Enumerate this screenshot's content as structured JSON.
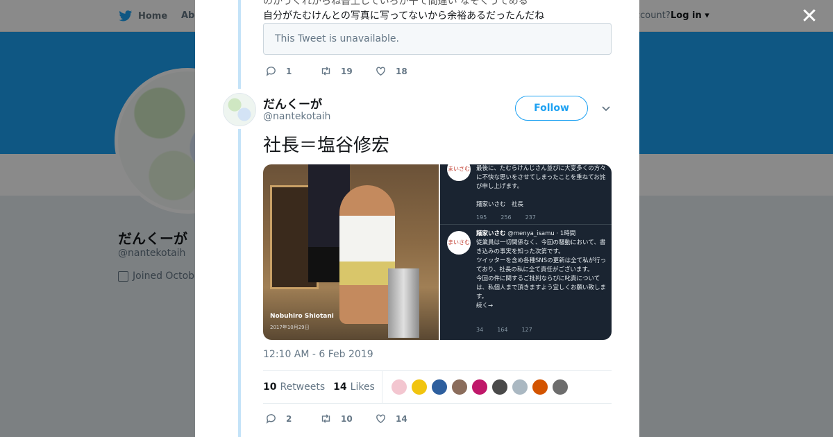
{
  "topbar": {
    "home_label": "Home",
    "about_label": "Abo",
    "account_text": "ccount?",
    "login_label": "Log in ▾"
  },
  "profile": {
    "name": "だんくーが",
    "handle": "@nantekotaih",
    "joined": "Joined Octobe"
  },
  "previous_tweet": {
    "text_line1": "のかうくれがらね普上していろが干て間違い なそくうてめる",
    "text_line2": "自分がたむけんとの写真に写ってないから余裕あるだったんだね",
    "unavailable_text": "This Tweet is unavailable.",
    "replies": "1",
    "retweets": "19",
    "likes": "18"
  },
  "tweet": {
    "name": "だんくーが",
    "handle": "@nantekotaih",
    "follow_label": "Follow",
    "text": "社長＝塩谷修宏",
    "timestamp": "12:10 AM - 6 Feb 2019",
    "retweets_count": "10",
    "retweets_label": "Retweets",
    "likes_count": "14",
    "likes_label": "Likes",
    "replies": "2",
    "retweets": "10",
    "likes": "14",
    "media_left": {
      "caption": "Nobuhiro Shiotani",
      "date": "2017年10月29日"
    },
    "media_right": {
      "avatar_text": "まいさむ",
      "text1": "最後に、たむらけんじさん並びに大変多くの方々に不快な思いをさせてしまったことを重ねてお詫び申し上げます。\n\n麺家いさむ　社長",
      "stats1": {
        "replies": "195",
        "retweets": "256",
        "likes": "237"
      },
      "head_name": "麺家いさむ",
      "head_meta": "@menya_isamu · 1時間",
      "text2": "従業員は一切関係なく、今回の騒動において、書き込みの事実を知った次第です。\nツイッターを含め各種SNSの更新は全て私が行っており、社長の私に全て責任がございます。\n今回の件に関するご批判ならびに叱責については、私個人まで頂きますよう宜しくお願い致します。\n続く→",
      "stats2": {
        "replies": "34",
        "retweets": "164",
        "likes": "127"
      }
    }
  },
  "likers": [
    "#f3c6d0",
    "#f1c40f",
    "#2e5f9e",
    "#8b6d5c",
    "#c0186a",
    "#4a4a4a",
    "#aab8c2",
    "#d35400",
    "#6d6d6d"
  ],
  "colors": {
    "accent": "#1da1f2",
    "text": "#14171a",
    "muted": "#657786"
  }
}
